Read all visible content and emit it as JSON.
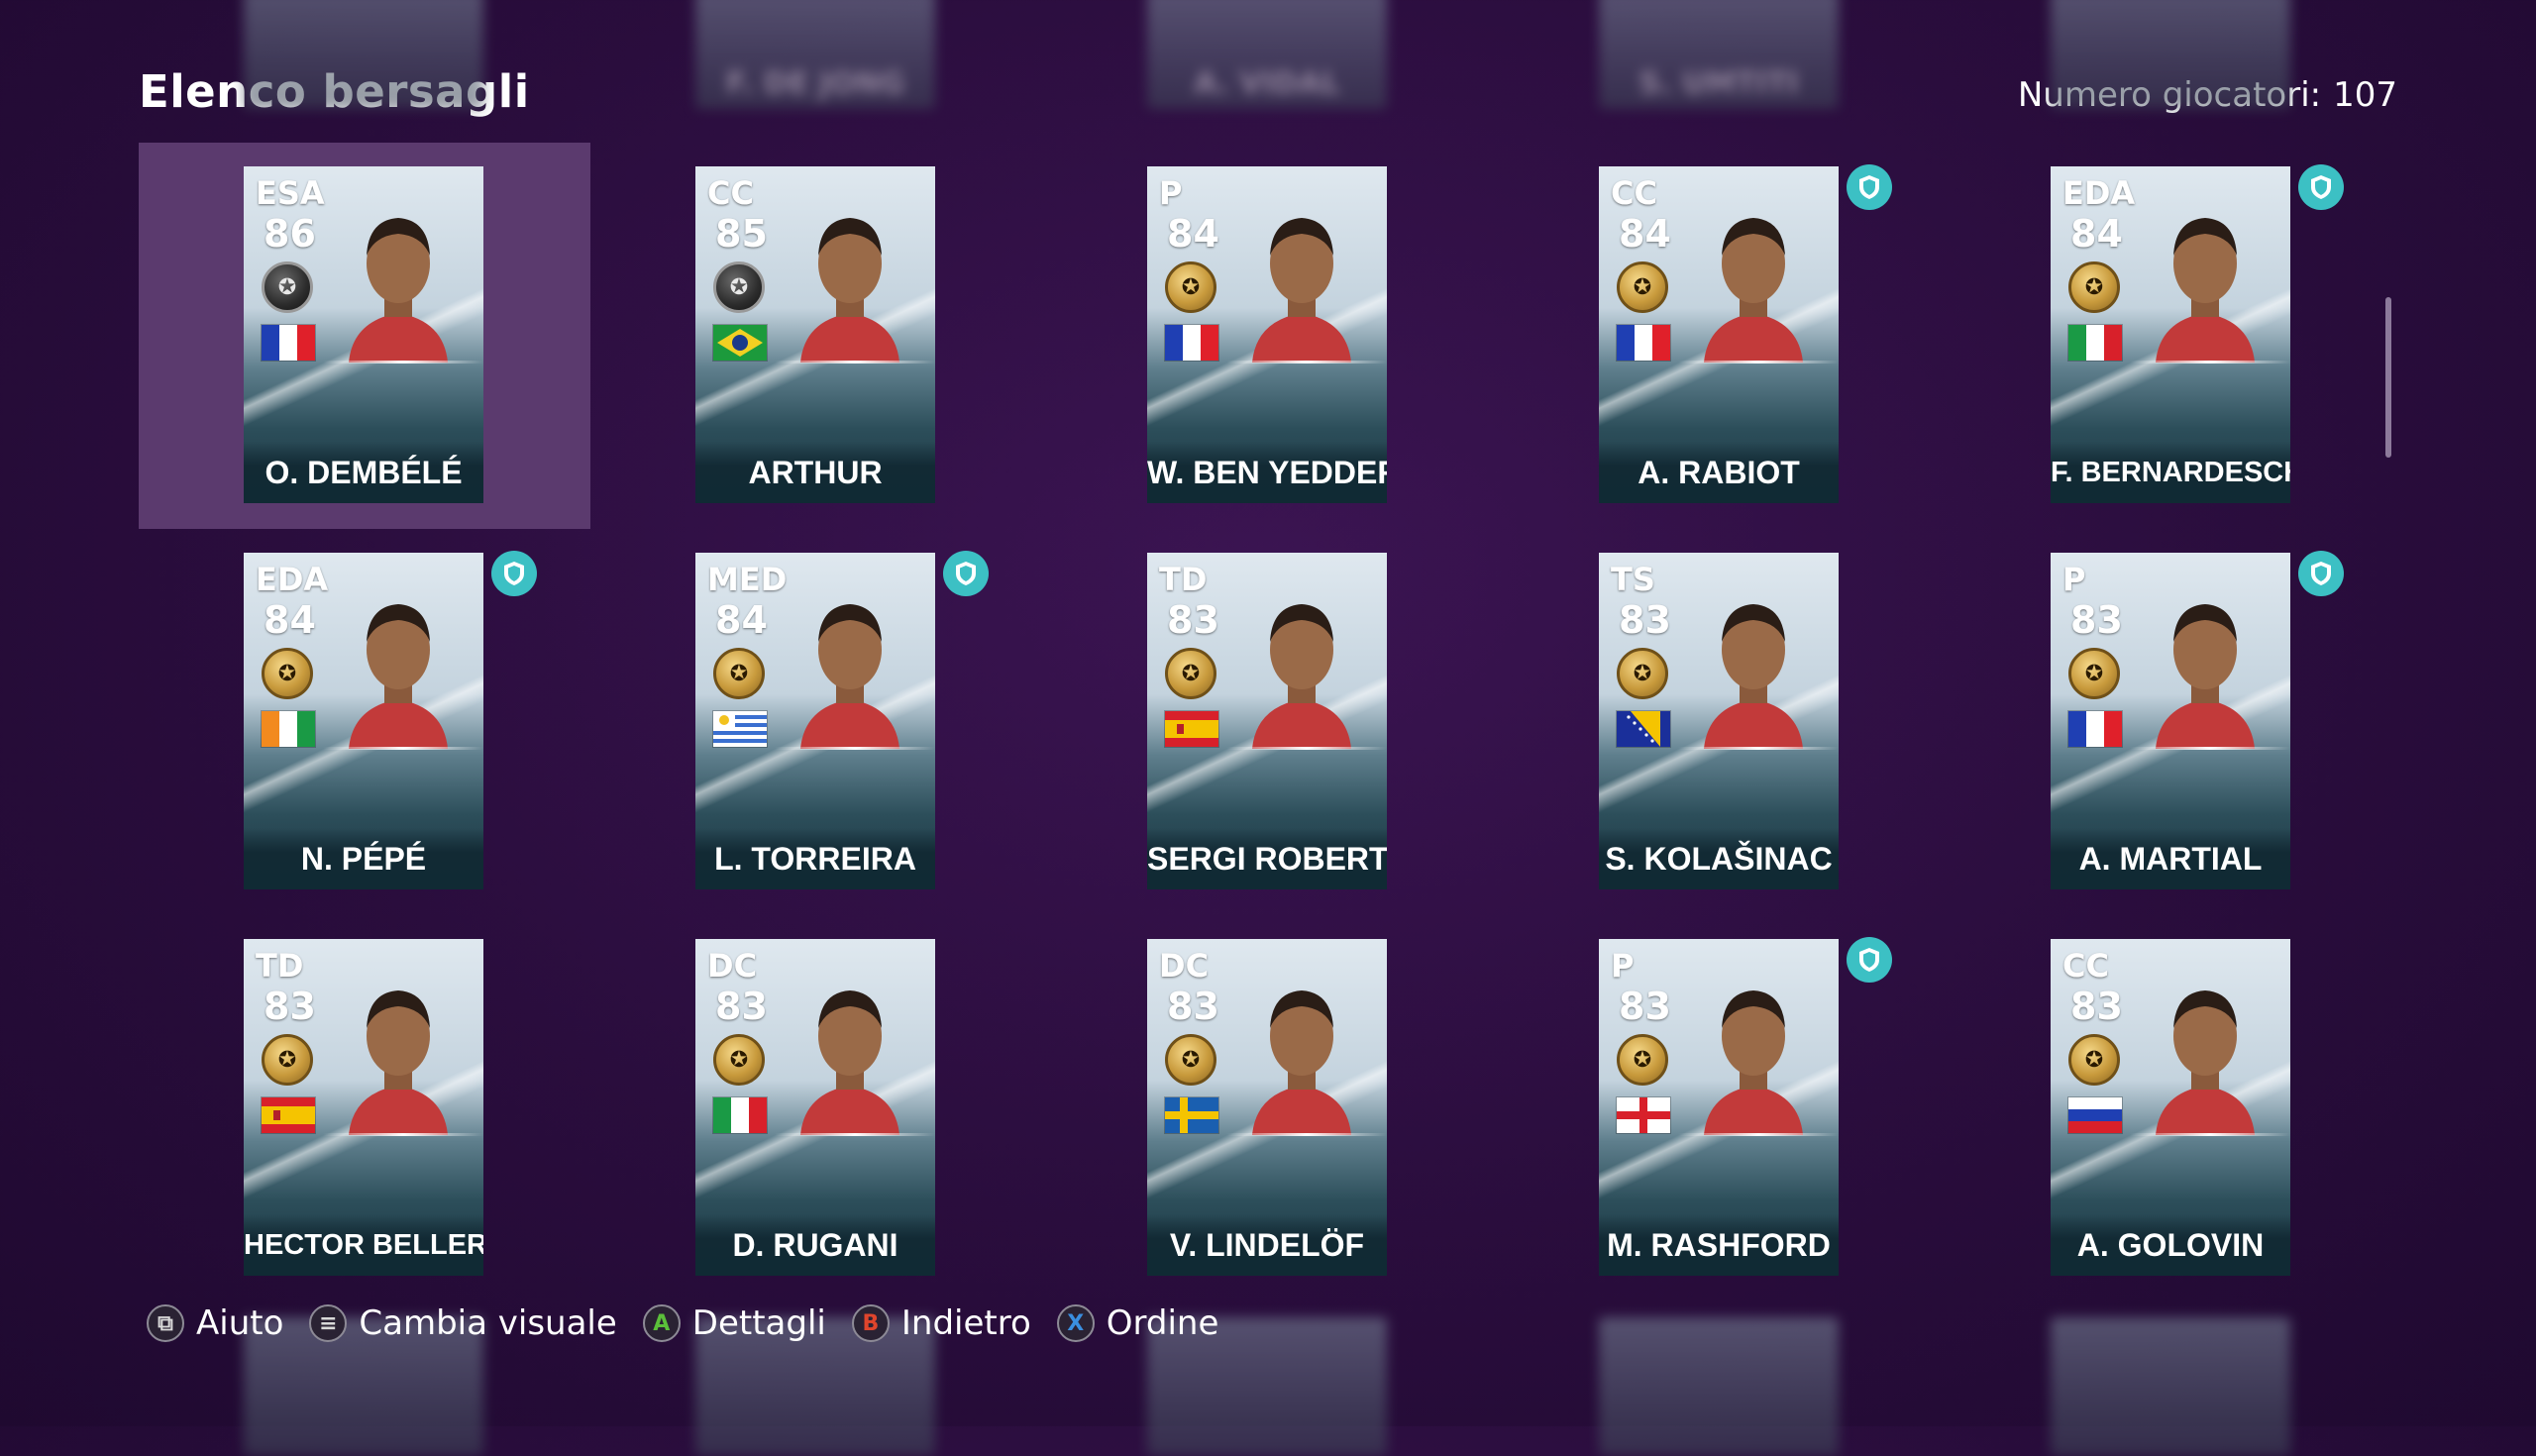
{
  "header": {
    "title": "Elenco bersagli",
    "count_label": "Numero giocatori:",
    "count_value": "107"
  },
  "ghost_top": [
    {
      "name": ""
    },
    {
      "name": "F. DE JONG"
    },
    {
      "name": "A. VIDAL"
    },
    {
      "name": "S. UMTITI"
    },
    {
      "name": ""
    }
  ],
  "players": [
    {
      "pos": "ESA",
      "rating": "86",
      "name": "O. DEMBÉLÉ",
      "flag": "france",
      "medal": "black",
      "shield": false,
      "selected": true
    },
    {
      "pos": "CC",
      "rating": "85",
      "name": "ARTHUR",
      "flag": "brazil",
      "medal": "black",
      "shield": false
    },
    {
      "pos": "P",
      "rating": "84",
      "name": "W. BEN YEDDER",
      "flag": "france",
      "medal": "gold",
      "shield": false
    },
    {
      "pos": "CC",
      "rating": "84",
      "name": "A. RABIOT",
      "flag": "france",
      "medal": "gold",
      "shield": true
    },
    {
      "pos": "EDA",
      "rating": "84",
      "name": "F. BERNARDESCHI",
      "flag": "italy",
      "medal": "gold",
      "shield": true
    },
    {
      "pos": "EDA",
      "rating": "84",
      "name": "N. PÉPÉ",
      "flag": "ivory-coast",
      "medal": "gold",
      "shield": true
    },
    {
      "pos": "MED",
      "rating": "84",
      "name": "L. TORREIRA",
      "flag": "uruguay",
      "medal": "gold",
      "shield": true
    },
    {
      "pos": "TD",
      "rating": "83",
      "name": "SERGI ROBERTO",
      "flag": "spain",
      "medal": "gold",
      "shield": false
    },
    {
      "pos": "TS",
      "rating": "83",
      "name": "S. KOLAŠINAC",
      "flag": "bosnia",
      "medal": "gold",
      "shield": false
    },
    {
      "pos": "P",
      "rating": "83",
      "name": "A. MARTIAL",
      "flag": "france",
      "medal": "gold",
      "shield": true
    },
    {
      "pos": "TD",
      "rating": "83",
      "name": "HECTOR BELLERÍN",
      "flag": "spain",
      "medal": "gold",
      "shield": false
    },
    {
      "pos": "DC",
      "rating": "83",
      "name": "D. RUGANI",
      "flag": "italy",
      "medal": "gold",
      "shield": false
    },
    {
      "pos": "DC",
      "rating": "83",
      "name": "V. LINDELÖF",
      "flag": "sweden",
      "medal": "gold",
      "shield": false
    },
    {
      "pos": "P",
      "rating": "83",
      "name": "M. RASHFORD",
      "flag": "england",
      "medal": "gold",
      "shield": true
    },
    {
      "pos": "CC",
      "rating": "83",
      "name": "A. GOLOVIN",
      "flag": "russia",
      "medal": "gold",
      "shield": false
    }
  ],
  "footer": [
    {
      "icon": "touchpad-icon",
      "glyph": "⧉",
      "label": "Aiuto",
      "color": "#d9d9d9"
    },
    {
      "icon": "options-icon",
      "glyph": "≡",
      "label": "Cambia visuale",
      "color": "#d9d9d9"
    },
    {
      "icon": "a-button-icon",
      "glyph": "A",
      "label": "Dettagli",
      "color": "#5bbf3a"
    },
    {
      "icon": "b-button-icon",
      "glyph": "B",
      "label": "Indietro",
      "color": "#e0452c"
    },
    {
      "icon": "x-button-icon",
      "glyph": "X",
      "label": "Ordine",
      "color": "#3a8fe0"
    }
  ],
  "colors": {
    "background": "#2a0d3d",
    "selected_cell": "#5b3a6e",
    "shield": "#3cc0c4",
    "medal_gold": "#c89a3c"
  }
}
